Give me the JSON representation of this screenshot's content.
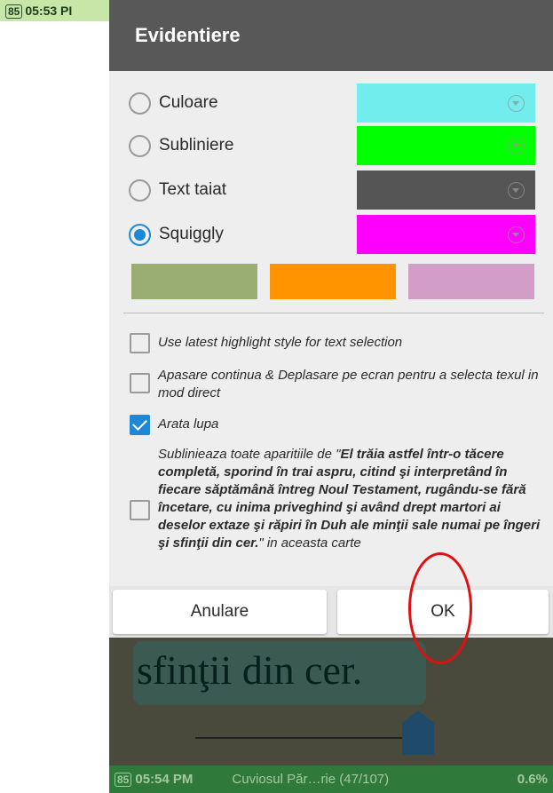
{
  "top_status": {
    "battery": "85",
    "time": "05:53 PI"
  },
  "book": {
    "visible_text": "sfinţii din cer."
  },
  "bottom_status": {
    "battery": "85",
    "time": "05:54 PM",
    "book_title": "Cuviosul Păr…rie (47/107)",
    "percent": "0.6%"
  },
  "dialog": {
    "title": "Evidentiere",
    "styles": [
      {
        "label": "Culoare",
        "color": "#72eded",
        "checked": false
      },
      {
        "label": "Subliniere",
        "color": "#00ff00",
        "checked": false
      },
      {
        "label": "Text taiat",
        "color": "#555555",
        "checked": false
      },
      {
        "label": "Squiggly",
        "color": "#ff00ff",
        "checked": true
      }
    ],
    "preset_colors": [
      "#9aae74",
      "#ff9400",
      "#d29ec7"
    ],
    "options": [
      {
        "text": "Use latest highlight style for text selection",
        "checked": false
      },
      {
        "text": "Apasare continua & Deplasare pe ecran pentru a selecta texul in mod direct",
        "checked": false
      },
      {
        "text": "Arata lupa",
        "checked": true
      }
    ],
    "underline_all": {
      "prefix": "Sublinieaza toate aparitiile de \"",
      "quote": "El trăia astfel într-o tăcere completă, sporind în trai aspru, citind şi interpretând în fiecare săptămână întreg Noul Testament, rugându-se fără încetare, cu inima priveghind şi având drept martori ai deselor extaze şi răpiri în Duh ale minţii sale numai pe îngeri şi sfinţii din cer.",
      "suffix": "\" in aceasta carte",
      "checked": false
    },
    "buttons": {
      "cancel": "Anulare",
      "ok": "OK"
    }
  }
}
